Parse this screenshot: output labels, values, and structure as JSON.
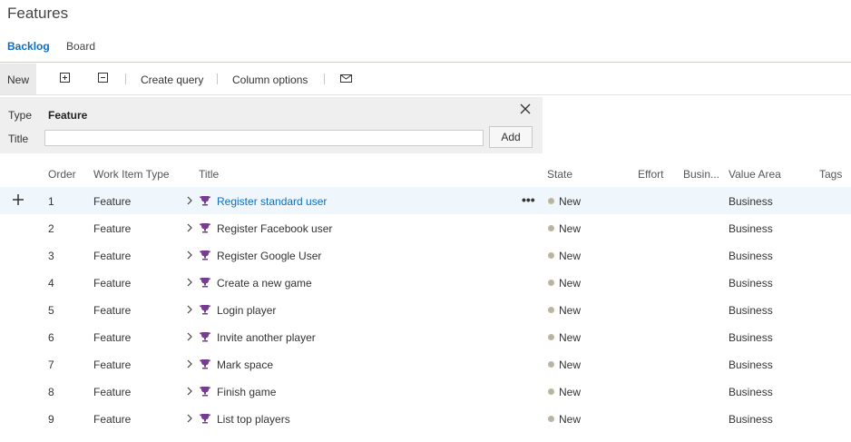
{
  "page": {
    "title": "Features"
  },
  "tabs": [
    {
      "label": "Backlog",
      "active": true
    },
    {
      "label": "Board",
      "active": false
    }
  ],
  "toolbar": {
    "new_label": "New",
    "expand_icon": "expand-all-icon",
    "collapse_icon": "collapse-all-icon",
    "create_query_label": "Create query",
    "column_options_label": "Column options",
    "email_icon": "mail-icon"
  },
  "add_panel": {
    "type_label": "Type",
    "type_value": "Feature",
    "title_label": "Title",
    "title_value": "",
    "add_button": "Add",
    "close_icon": "close-icon"
  },
  "columns": [
    "Order",
    "Work Item Type",
    "Title",
    "State",
    "Effort",
    "Busin...",
    "Value Area",
    "Tags"
  ],
  "rows": [
    {
      "order": "1",
      "type": "Feature",
      "title": "Register standard user",
      "state": "New",
      "value_area": "Business"
    },
    {
      "order": "2",
      "type": "Feature",
      "title": "Register Facebook user",
      "state": "New",
      "value_area": "Business"
    },
    {
      "order": "3",
      "type": "Feature",
      "title": "Register Google User",
      "state": "New",
      "value_area": "Business"
    },
    {
      "order": "4",
      "type": "Feature",
      "title": "Create a new game",
      "state": "New",
      "value_area": "Business"
    },
    {
      "order": "5",
      "type": "Feature",
      "title": "Login player",
      "state": "New",
      "value_area": "Business"
    },
    {
      "order": "6",
      "type": "Feature",
      "title": "Invite another player",
      "state": "New",
      "value_area": "Business"
    },
    {
      "order": "7",
      "type": "Feature",
      "title": "Mark space",
      "state": "New",
      "value_area": "Business"
    },
    {
      "order": "8",
      "type": "Feature",
      "title": "Finish game",
      "state": "New",
      "value_area": "Business"
    },
    {
      "order": "9",
      "type": "Feature",
      "title": "List top players",
      "state": "New",
      "value_area": "Business"
    }
  ],
  "selected_row_more": "•••",
  "colors": {
    "accent": "#106ebe",
    "selected_row": "#eff6fc",
    "trophy": "#773b93",
    "panel": "#efefef"
  }
}
